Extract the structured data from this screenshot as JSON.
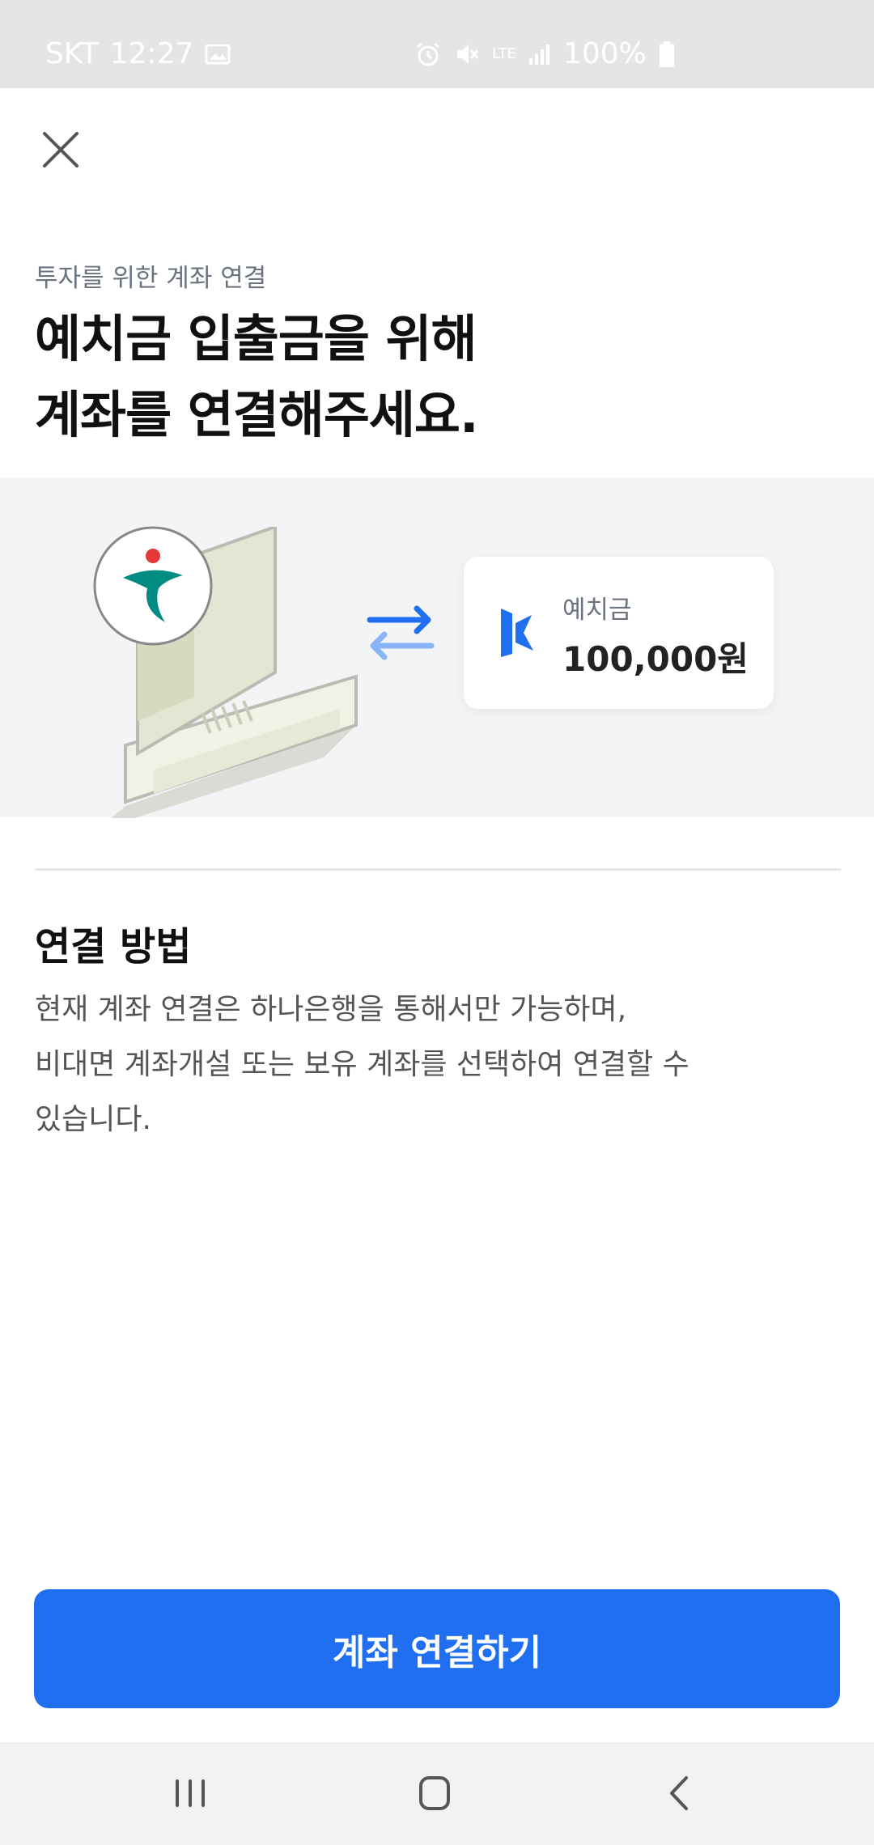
{
  "status_bar": {
    "carrier": "SKT",
    "time": "12:27",
    "network": "LTE",
    "battery": "100%",
    "icons": [
      "image-icon",
      "alarm-icon",
      "mute-icon",
      "signal-icon",
      "battery-icon"
    ]
  },
  "header": {
    "subtitle": "투자를 위한 계좌 연결",
    "title_line1": "예치금 입출금을 위해",
    "title_line2": "계좌를 연결해주세요."
  },
  "illustration": {
    "card_label": "예치금",
    "card_amount": "100,000원",
    "accent": "#1f6ff0",
    "bank_logo_colors": [
      "#008c82",
      "#e53935"
    ]
  },
  "section": {
    "title": "연결 방법",
    "body_line1": "현재 계좌 연결은 하나은행을 통해서만 가능하며,",
    "body_line2": "비대면 계좌개설 또는 보유 계좌를 선택하여 연결할 수",
    "body_line3": "있습니다."
  },
  "cta": {
    "label": "계좌 연결하기",
    "color": "#1f6ff0"
  },
  "nav": {
    "icons": [
      "recent-apps-icon",
      "home-icon",
      "back-icon"
    ]
  }
}
